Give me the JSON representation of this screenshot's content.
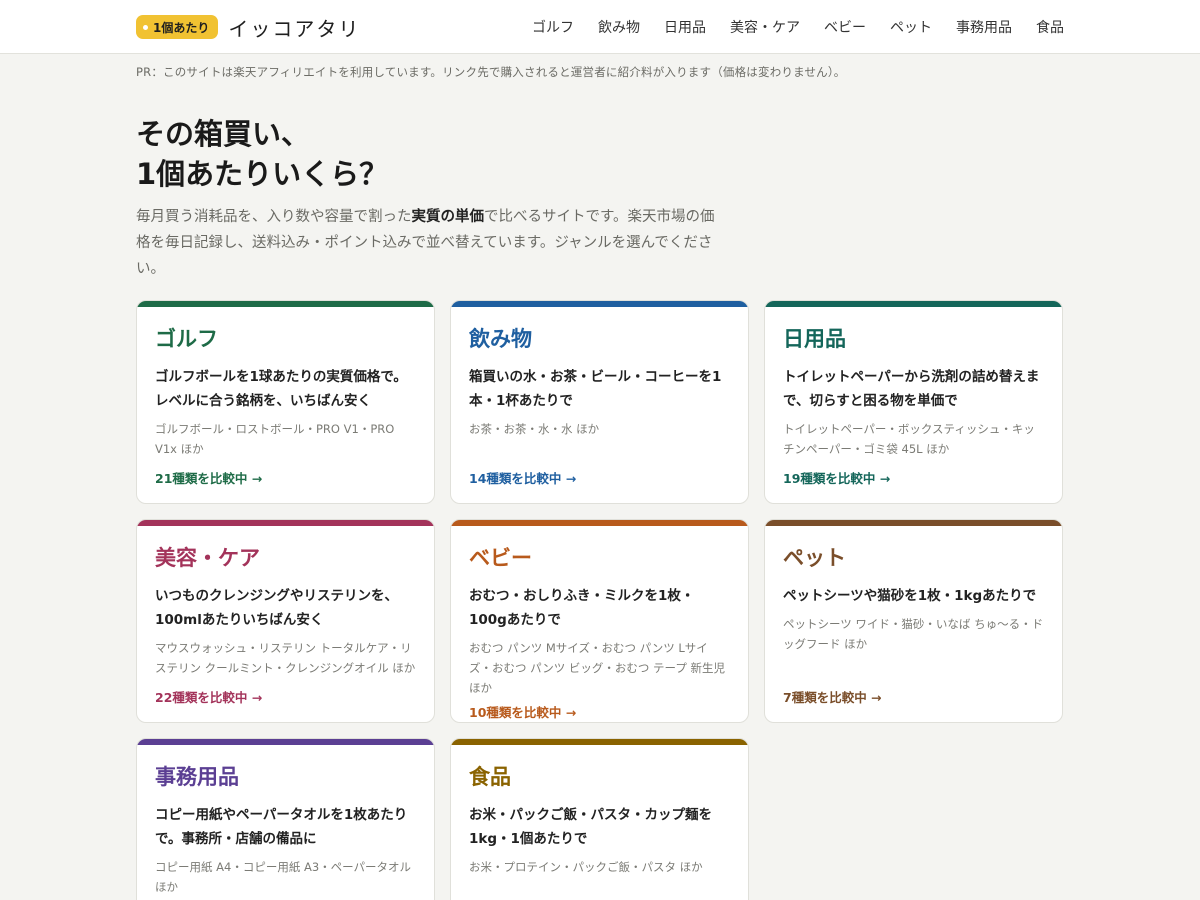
{
  "header": {
    "badge": "1個あたり",
    "site_name": "イッコアタリ",
    "nav": [
      "ゴルフ",
      "飲み物",
      "日用品",
      "美容・ケア",
      "ベビー",
      "ペット",
      "事務用品",
      "食品"
    ]
  },
  "pr_note": "PR：このサイトは楽天アフィリエイトを利用しています。リンク先で購入されると運営者に紹介料が入ります（価格は変わりません）。",
  "hero": {
    "title_line1": "その箱買い、",
    "title_line2": "1個あたりいくら？",
    "desc_before": "毎月買う消耗品を、入り数や容量で割った",
    "desc_strong": "実質の単価",
    "desc_after": "で比べるサイトです。楽天市場の価格を毎日記録し、送料込み・ポイント込みで並べ替えています。ジャンルを選んでください。"
  },
  "categories": [
    {
      "title": "ゴルフ",
      "lead": "ゴルフボールを1球あたりの実質価格で。レベルに合う銘柄を、いちばん安く",
      "items": "ゴルフボール・ロストボール・PRO V1・PRO V1x ほか",
      "count": "21種類を比較中 →",
      "color": "#1e6b47"
    },
    {
      "title": "飲み物",
      "lead": "箱買いの水・お茶・ビール・コーヒーを1本・1杯あたりで",
      "items": "お茶・お茶・水・水 ほか",
      "count": "14種類を比較中 →",
      "color": "#1f5fa0"
    },
    {
      "title": "日用品",
      "lead": "トイレットペーパーから洗剤の詰め替えまで、切らすと困る物を単価で",
      "items": "トイレットペーパー・ボックスティッシュ・キッチンペーパー・ゴミ袋 45L ほか",
      "count": "19種類を比較中 →",
      "color": "#14665a"
    },
    {
      "title": "美容・ケア",
      "lead": "いつものクレンジングやリステリンを、100mlあたりいちばん安く",
      "items": "マウスウォッシュ・リステリン トータルケア・リステリン クールミント・クレンジングオイル ほか",
      "count": "22種類を比較中 →",
      "color": "#a3335a"
    },
    {
      "title": "ベビー",
      "lead": "おむつ・おしりふき・ミルクを1枚・100gあたりで",
      "items": "おむつ パンツ Mサイズ・おむつ パンツ Lサイズ・おむつ パンツ ビッグ・おむつ テープ 新生児 ほか",
      "count": "10種類を比較中 →",
      "color": "#b85a1c"
    },
    {
      "title": "ペット",
      "lead": "ペットシーツや猫砂を1枚・1kgあたりで",
      "items": "ペットシーツ ワイド・猫砂・いなば ちゅ〜る・ドッグフード ほか",
      "count": "7種類を比較中 →",
      "color": "#7a4e2a"
    },
    {
      "title": "事務用品",
      "lead": "コピー用紙やペーパータオルを1枚あたりで。事務所・店舗の備品に",
      "items": "コピー用紙 A4・コピー用紙 A3・ペーパータオル ほか",
      "count": "",
      "color": "#5b3f93"
    },
    {
      "title": "食品",
      "lead": "お米・パックご飯・パスタ・カップ麺を1kg・1個あたりで",
      "items": "お米・プロテイン・パックご飯・パスタ ほか",
      "count": "",
      "color": "#8a6300"
    }
  ]
}
